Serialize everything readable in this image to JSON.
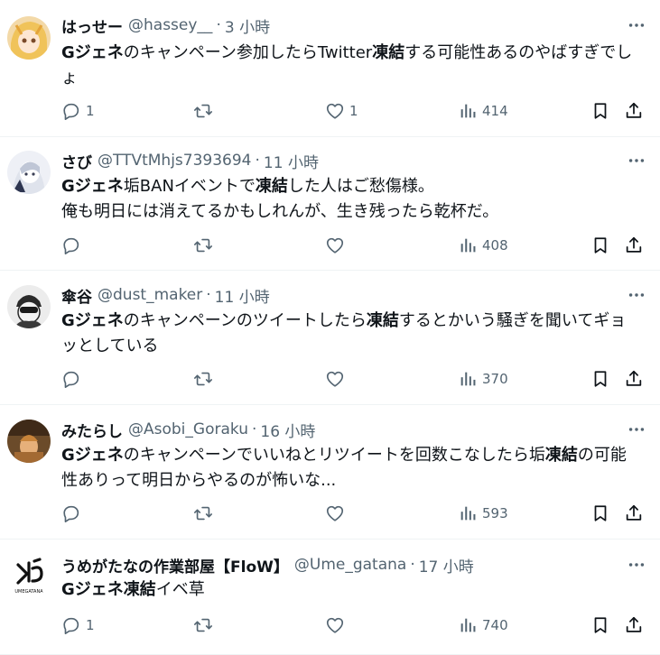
{
  "tweets": [
    {
      "name": "はっせー",
      "handle": "@hassey__",
      "time": "3 小時",
      "text": [
        {
          "t": "Gジェネ",
          "b": true
        },
        {
          "t": "のキャンペーン参加したらTwitter",
          "b": false
        },
        {
          "t": "凍結",
          "b": true
        },
        {
          "t": "する可能性あるのやばすぎでしょ",
          "b": false
        }
      ],
      "replies": "1",
      "retweets": "",
      "likes": "1",
      "views": "414",
      "avatar_color": "#e8c48a"
    },
    {
      "name": "さび",
      "handle": "@TTVtMhjs7393694",
      "time": "11 小時",
      "text": [
        {
          "t": "Gジェネ",
          "b": true
        },
        {
          "t": "垢BANイベントで",
          "b": false
        },
        {
          "t": "凍結",
          "b": true
        },
        {
          "t": "した人はご愁傷様。\n俺も明日には消えてるかもしれんが、生き残ったら乾杯だ。",
          "b": false
        }
      ],
      "replies": "",
      "retweets": "",
      "likes": "",
      "views": "408",
      "avatar_color": "#c9d0e0"
    },
    {
      "name": "傘谷",
      "handle": "@dust_maker",
      "time": "11 小時",
      "text": [
        {
          "t": "Gジェネ",
          "b": true
        },
        {
          "t": "のキャンペーンのツイートしたら",
          "b": false
        },
        {
          "t": "凍結",
          "b": true
        },
        {
          "t": "するとかいう騒ぎを聞いてギョッとしている",
          "b": false
        }
      ],
      "replies": "",
      "retweets": "",
      "likes": "",
      "views": "370",
      "avatar_color": "#d8d8d8"
    },
    {
      "name": "みたらし",
      "handle": "@Asobi_Goraku",
      "time": "16 小時",
      "text": [
        {
          "t": "Gジェネ",
          "b": true
        },
        {
          "t": "のキャンペーンでいいねとリツイートを回数こなしたら垢",
          "b": false
        },
        {
          "t": "凍結",
          "b": true
        },
        {
          "t": "の可能性ありって明日からやるのが怖いな...",
          "b": false
        }
      ],
      "replies": "",
      "retweets": "",
      "likes": "",
      "views": "593",
      "avatar_color": "#8a6a3a"
    },
    {
      "name": "うめがたなの作業部屋【FloW】",
      "handle": "@Ume_gatana",
      "time": "17 小時",
      "text": [
        {
          "t": "Gジェネ",
          "b": true
        },
        {
          "t": "凍結",
          "b": true
        },
        {
          "t": "イベ草",
          "b": false
        }
      ],
      "replies": "1",
      "retweets": "",
      "likes": "",
      "views": "740",
      "avatar_color": "#ffffff",
      "avatar_logo_text": "UMEGATANA"
    }
  ],
  "colors": {
    "text": "#0f1419",
    "muted": "#536471",
    "divider": "#eff3f4"
  },
  "icons": [
    "reply-icon",
    "retweet-icon",
    "like-icon",
    "views-icon",
    "bookmark-icon",
    "share-icon",
    "more-icon"
  ]
}
